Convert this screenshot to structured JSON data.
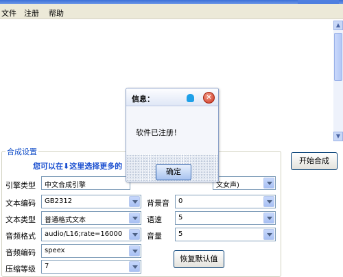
{
  "menu": {
    "file": "文件",
    "register": "注册",
    "help": "帮助"
  },
  "settings": {
    "group_title": "合成设置",
    "hint": "您可以在⬇这里选择更多的",
    "engine": {
      "label": "引擎类型",
      "value": "中文合成引擎"
    },
    "voice": {
      "value": "文女声)"
    },
    "text_encoding": {
      "label": "文本编码",
      "value": "GB2312"
    },
    "bg_sound": {
      "label": "背景音",
      "value": "0"
    },
    "text_type": {
      "label": "文本类型",
      "value": "普通格式文本"
    },
    "speed": {
      "label": "语速",
      "value": "5"
    },
    "audio_format": {
      "label": "音频格式",
      "value": "audio/L16;rate=16000"
    },
    "volume": {
      "label": "音量",
      "value": "5"
    },
    "audio_encoding": {
      "label": "音频编码",
      "value": "speex"
    },
    "compression": {
      "label": "压缩等级",
      "value": "7"
    },
    "restore_default": "恢复默认值",
    "start_synthesis": "开始合成"
  },
  "dialog": {
    "title": "信息：",
    "message": "软件已注册！",
    "ok": "确定"
  },
  "icons": {
    "info": "info-icon",
    "close": "close-icon",
    "dropdown": "chevron-down-icon"
  }
}
